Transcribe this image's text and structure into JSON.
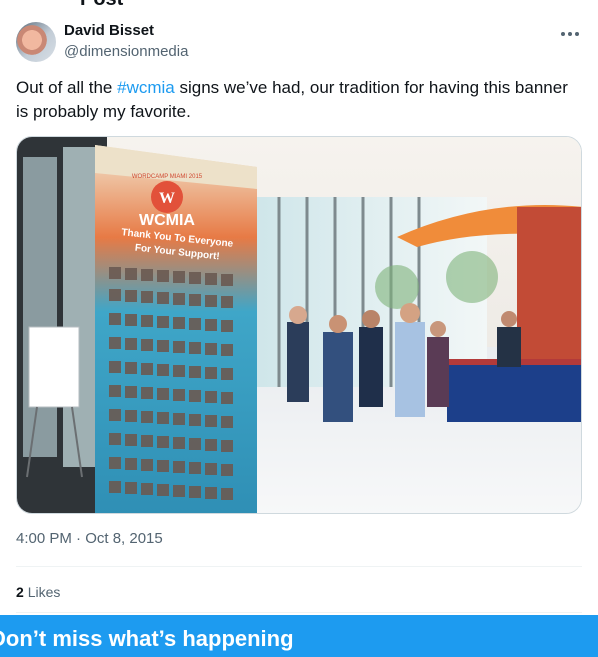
{
  "page": {
    "header_clip": "Post"
  },
  "author": {
    "name": "David Bisset",
    "handle": "@dimensionmedia",
    "more_icon": "more-horizontal-icon"
  },
  "tweet": {
    "text_before": "Out of all the ",
    "hashtag": "#wcmia",
    "text_after": " signs we’ve had, our tradition for having this banner is probably my favorite."
  },
  "media": {
    "banner": {
      "logo_text": "WCMIA",
      "logo_arc": "WORDCAMP MIAMI 2015",
      "line1": "Thank You To Everyone",
      "line2": "For Your Support!"
    }
  },
  "timestamp": "4:00 PM · Oct 8, 2015",
  "likes": {
    "count": "2",
    "label": "Likes"
  },
  "signup_banner": {
    "text": "Don’t miss what’s happening"
  },
  "colors": {
    "accent": "#1d9bf0",
    "secondary_text": "#536471",
    "border": "#cfd9de"
  }
}
